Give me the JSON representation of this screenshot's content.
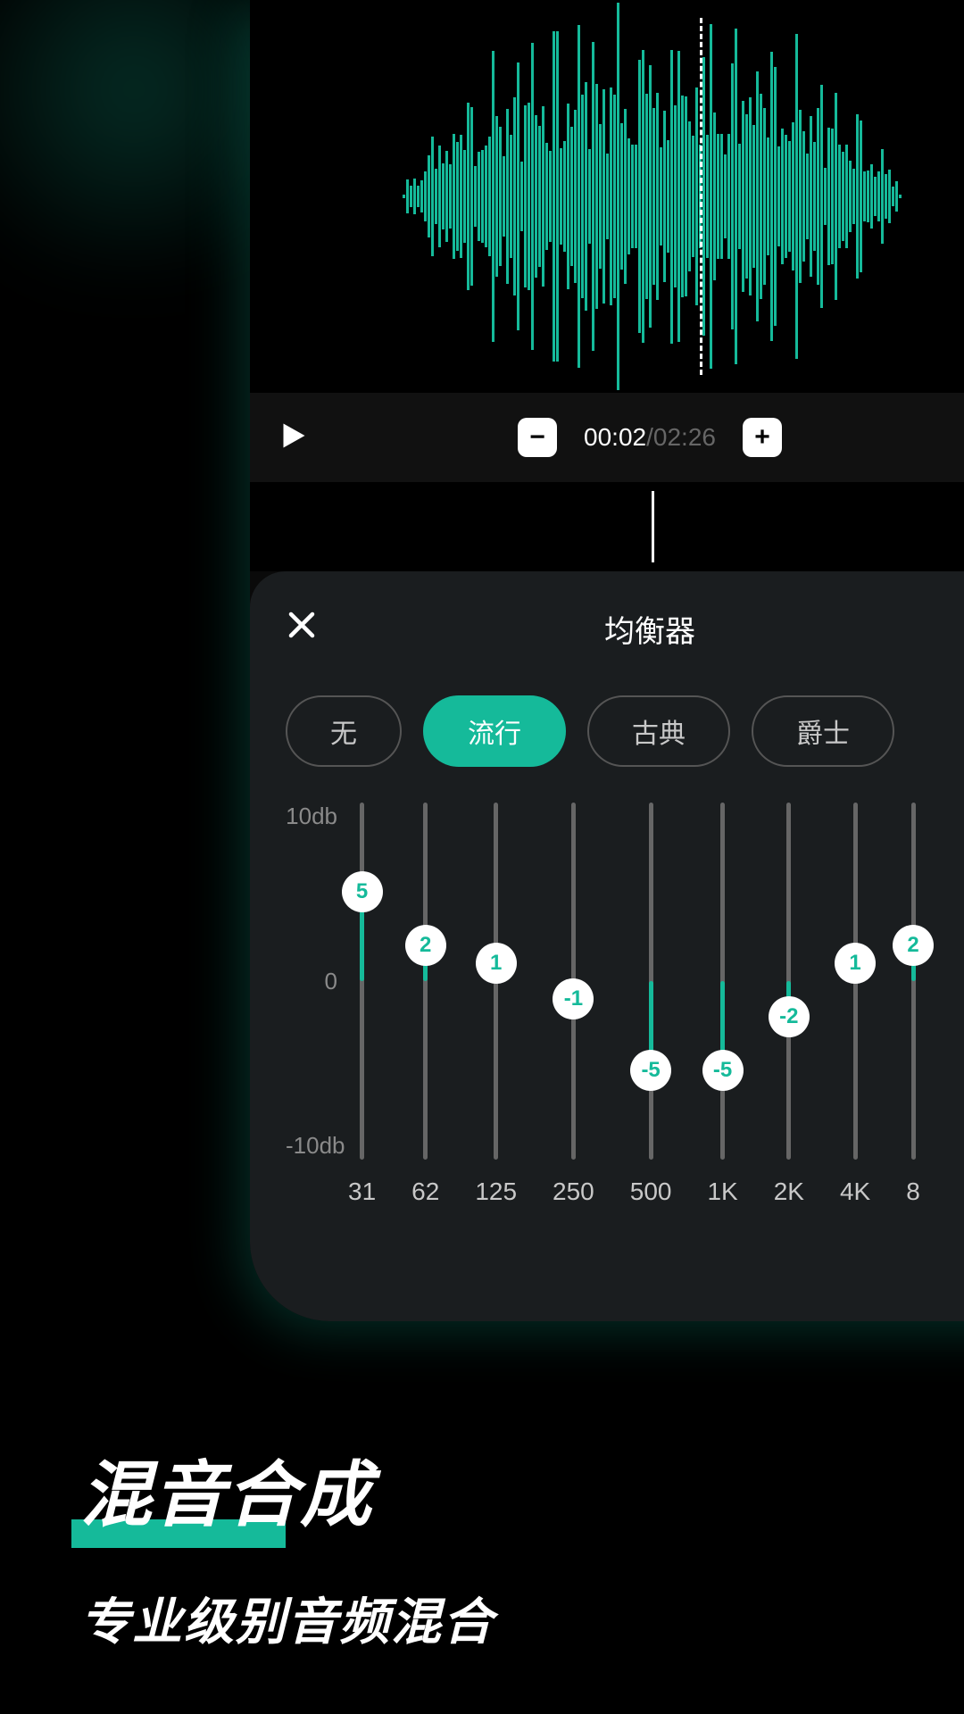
{
  "transport": {
    "current_time": "00:02",
    "total_time": "/02:26"
  },
  "equalizer": {
    "title": "均衡器",
    "y_max_label": "10db",
    "y_mid_label": "0",
    "y_min_label": "-10db",
    "range": 10,
    "presets": [
      {
        "label": "无",
        "active": false
      },
      {
        "label": "流行",
        "active": true
      },
      {
        "label": "古典",
        "active": false
      },
      {
        "label": "爵士",
        "active": false
      }
    ],
    "bands": [
      {
        "freq": "31",
        "value": 5
      },
      {
        "freq": "62",
        "value": 2
      },
      {
        "freq": "125",
        "value": 1
      },
      {
        "freq": "250",
        "value": -1
      },
      {
        "freq": "500",
        "value": -5
      },
      {
        "freq": "1K",
        "value": -5
      },
      {
        "freq": "2K",
        "value": -2
      },
      {
        "freq": "4K",
        "value": 1
      },
      {
        "freq": "8",
        "value": 2
      }
    ]
  },
  "promo": {
    "title": "混音合成",
    "subtitle": "专业级别音频混合"
  }
}
